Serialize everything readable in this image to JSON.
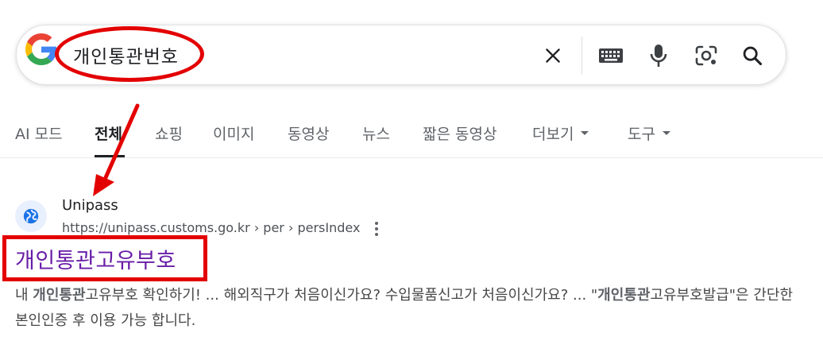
{
  "search": {
    "query": "개인통관번호"
  },
  "search_buttons": [
    "clear-icon",
    "keyboard-icon",
    "mic-icon",
    "lens-icon",
    "search-icon"
  ],
  "tabs": [
    {
      "label": "AI 모드"
    },
    {
      "label": "전체"
    },
    {
      "label": "쇼핑"
    },
    {
      "label": "이미지"
    },
    {
      "label": "동영상"
    },
    {
      "label": "뉴스"
    },
    {
      "label": "짧은 동영상"
    },
    {
      "label": "더보기"
    },
    {
      "label": "도구"
    }
  ],
  "active_tab": "전체",
  "result": {
    "site_name": "Unipass",
    "url": "https://unipass.customs.go.kr › per › persIndex",
    "title": "개인통관고유부호",
    "snippet": [
      {
        "text": "내 ",
        "bold": false
      },
      {
        "text": "개인통관",
        "bold": true
      },
      {
        "text": "고유부호 확인하기! ... 해외직구가 처음이신가요? 수입물품신고가 처음이신가요? ... \"",
        "bold": false
      },
      {
        "text": "개인통관",
        "bold": true
      },
      {
        "text": "고유부호발급\"은 간단한 본인인증 후 이용 가능 합니다.",
        "bold": false
      }
    ]
  },
  "colors": {
    "annotation": "#e30000",
    "visited_link": "#681da8"
  }
}
